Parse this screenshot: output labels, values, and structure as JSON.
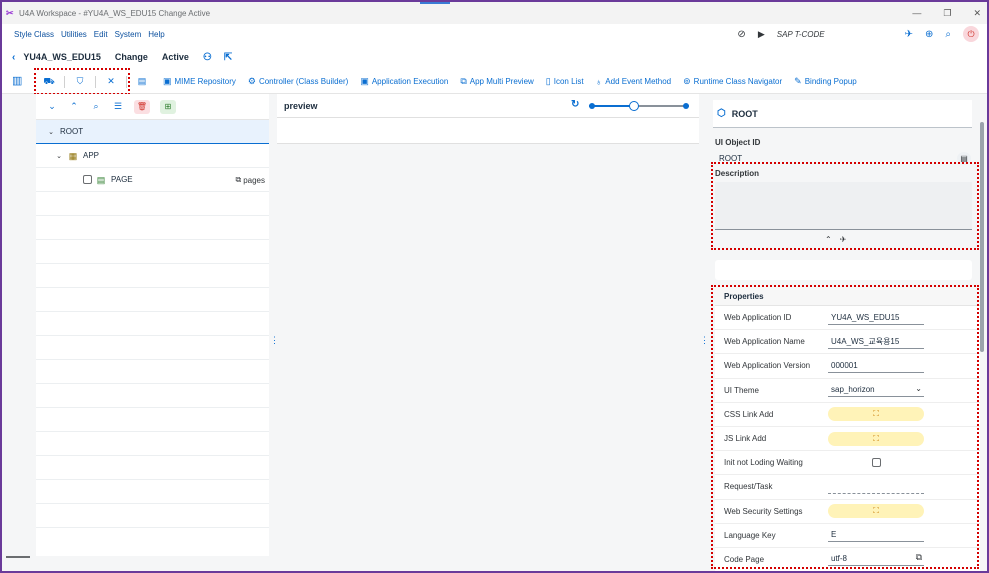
{
  "window": {
    "title": "U4A Workspace - #YU4A_WS_EDU15 Change Active",
    "controls": [
      "—",
      "❐",
      "✕"
    ]
  },
  "menu": {
    "items": [
      "Style Class",
      "Utilities",
      "Edit",
      "System",
      "Help"
    ],
    "tcode_label": "SAP T-CODE"
  },
  "header": {
    "app_id": "YU4A_WS_EDU15",
    "mode": "Change",
    "status": "Active"
  },
  "toolbar": {
    "buttons": [
      {
        "label": "MIME Repository",
        "icon": "image-icon"
      },
      {
        "label": "Controller (Class Builder)",
        "icon": "class-builder-icon"
      },
      {
        "label": "Application Execution",
        "icon": "execute-icon"
      },
      {
        "label": "App Multi Preview",
        "icon": "multi-preview-icon"
      },
      {
        "label": "Icon List",
        "icon": "list-icon"
      },
      {
        "label": "Add Event Method",
        "icon": "add-event-icon"
      },
      {
        "label": "Runtime Class Navigator",
        "icon": "location-icon"
      },
      {
        "label": "Binding Popup",
        "icon": "binding-icon"
      }
    ]
  },
  "tree": {
    "nodes": [
      {
        "label": "ROOT",
        "level": 0,
        "selected": true
      },
      {
        "label": "APP",
        "level": 1,
        "selected": false
      },
      {
        "label": "PAGE",
        "level": 2,
        "selected": false,
        "aggregation": "pages"
      }
    ]
  },
  "preview": {
    "title": "preview",
    "zoom_fraction": 0.45
  },
  "inspector": {
    "object_name": "ROOT",
    "ui_object_id_label": "UI Object ID",
    "ui_object_id_value": "ROOT",
    "description_label": "Description"
  },
  "properties": {
    "title": "Properties",
    "rows": [
      {
        "name": "Web Application ID",
        "value": "YU4A_WS_EDU15",
        "kind": "text"
      },
      {
        "name": "Web Application Name",
        "value": "U4A_WS_교육용15",
        "kind": "text"
      },
      {
        "name": "Web Application Version",
        "value": "000001",
        "kind": "text"
      },
      {
        "name": "UI Theme",
        "value": "sap_horizon",
        "kind": "select"
      },
      {
        "name": "CSS Link Add",
        "value": "",
        "kind": "button"
      },
      {
        "name": "JS Link Add",
        "value": "",
        "kind": "button"
      },
      {
        "name": "Init not Loding Waiting",
        "value": "",
        "kind": "checkbox"
      },
      {
        "name": "Request/Task",
        "value": "",
        "kind": "plain"
      },
      {
        "name": "Web Security Settings",
        "value": "",
        "kind": "button"
      },
      {
        "name": "Language Key",
        "value": "E",
        "kind": "text"
      },
      {
        "name": "Code Page",
        "value": "utf-8",
        "kind": "copy"
      }
    ]
  }
}
